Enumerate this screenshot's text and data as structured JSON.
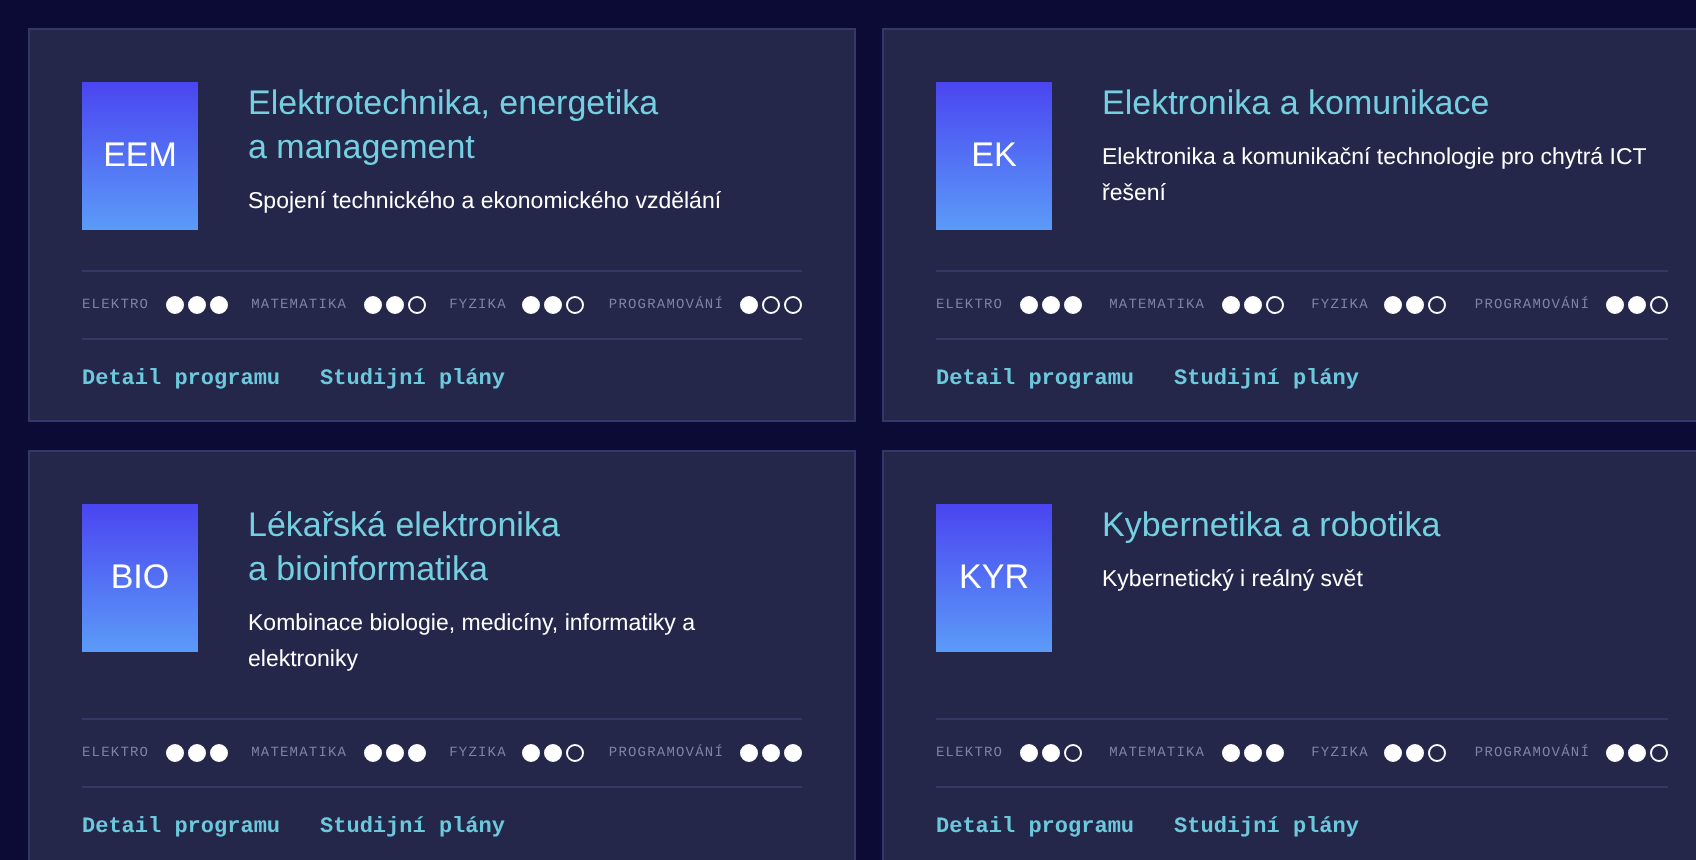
{
  "programs": [
    {
      "code": "EEM",
      "title": "Elektrotechnika, energetika\na management",
      "description": "Spojení technického a ekonomického vzdělání",
      "skills": [
        {
          "label": "ELEKTRO",
          "stars": 3
        },
        {
          "label": "MATEMATIKA",
          "stars": 2
        },
        {
          "label": "FYZIKA",
          "stars": 2
        },
        {
          "label": "PROGRAMOVÁNÍ",
          "stars": 1
        }
      ],
      "links": [
        "Detail programu",
        "Studijní plány"
      ]
    },
    {
      "code": "EK",
      "title": "Elektronika a komunikace",
      "description": "Elektronika a komunikační technologie pro chytrá ICT řešení",
      "skills": [
        {
          "label": "ELEKTRO",
          "stars": 3
        },
        {
          "label": "MATEMATIKA",
          "stars": 2
        },
        {
          "label": "FYZIKA",
          "stars": 2
        },
        {
          "label": "PROGRAMOVÁNÍ",
          "stars": 2
        }
      ],
      "links": [
        "Detail programu",
        "Studijní plány"
      ]
    },
    {
      "code": "BIO",
      "title": "Lékařská elektronika\na bioinformatika",
      "description": "Kombinace biologie, medicíny, informatiky a elektroniky",
      "skills": [
        {
          "label": "ELEKTRO",
          "stars": 3
        },
        {
          "label": "MATEMATIKA",
          "stars": 3
        },
        {
          "label": "FYZIKA",
          "stars": 2
        },
        {
          "label": "PROGRAMOVÁNÍ",
          "stars": 3
        }
      ],
      "links": [
        "Detail programu",
        "Studijní plány"
      ]
    },
    {
      "code": "KYR",
      "title": "Kybernetika a robotika",
      "description": "Kybernetický i reálný svět",
      "skills": [
        {
          "label": "ELEKTRO",
          "stars": 2
        },
        {
          "label": "MATEMATIKA",
          "stars": 3
        },
        {
          "label": "FYZIKA",
          "stars": 2
        },
        {
          "label": "PROGRAMOVÁNÍ",
          "stars": 2
        }
      ],
      "links": [
        "Detail programu",
        "Studijní plány"
      ]
    }
  ]
}
